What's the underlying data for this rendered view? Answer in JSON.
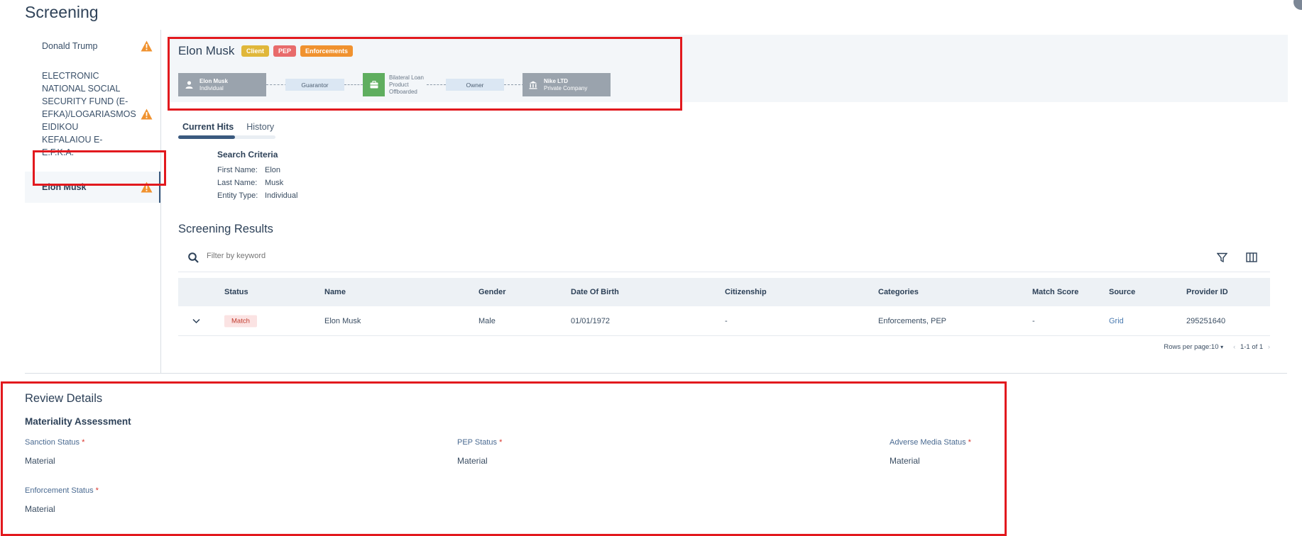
{
  "page": {
    "title": "Screening"
  },
  "sidebar": {
    "items": [
      {
        "label": "Donald Trump"
      },
      {
        "label": "ELECTRONIC NATIONAL SOCIAL SECURITY FUND (E-EFKA)/LOGARIASMOS EIDIKOU KEFALAIOU E-E.F.K.A."
      },
      {
        "label": "Elon Musk"
      }
    ]
  },
  "entity": {
    "name": "Elon Musk",
    "tags": [
      {
        "label": "Client",
        "color": "#e0b73a"
      },
      {
        "label": "PEP",
        "color": "#e86b6b"
      },
      {
        "label": "Enforcements",
        "color": "#f0922f"
      }
    ]
  },
  "flow": {
    "node1": {
      "title": "Elon Musk",
      "sub": "Individual"
    },
    "rel1": "Guarantor",
    "node2": {
      "title": "Bilateral Loan",
      "sub1": "Product",
      "sub2": "Offboarded"
    },
    "rel2": "Owner",
    "node3": {
      "title": "Nike LTD",
      "sub": "Private Company"
    }
  },
  "tabs": [
    {
      "label": "Current Hits"
    },
    {
      "label": "History"
    }
  ],
  "criteria": {
    "title": "Search Criteria",
    "rows": [
      {
        "key": "First Name:",
        "value": "Elon"
      },
      {
        "key": "Last Name:",
        "value": "Musk"
      },
      {
        "key": "Entity Type:",
        "value": "Individual"
      }
    ]
  },
  "results": {
    "title": "Screening Results",
    "search_placeholder": "Filter by keyword",
    "columns": [
      "Status",
      "Name",
      "Gender",
      "Date Of Birth",
      "Citizenship",
      "Categories",
      "Match Score",
      "Source",
      "Provider ID"
    ],
    "rows": [
      {
        "status": "Match",
        "name": "Elon Musk",
        "gender": "Male",
        "dob": "01/01/1972",
        "citizenship": "-",
        "categories": "Enforcements, PEP",
        "match_score": "-",
        "source": "Grid",
        "provider_id": "295251640"
      }
    ],
    "pager": {
      "rows_per_page": "Rows per page:10",
      "range": "1-1 of 1"
    }
  },
  "review": {
    "title": "Review Details",
    "subtitle": "Materiality Assessment",
    "fields": [
      {
        "label": "Sanction Status",
        "value": "Material"
      },
      {
        "label": "PEP Status",
        "value": "Material"
      },
      {
        "label": "Adverse Media Status",
        "value": "Material"
      },
      {
        "label": "Enforcement Status",
        "value": "Material"
      }
    ]
  }
}
